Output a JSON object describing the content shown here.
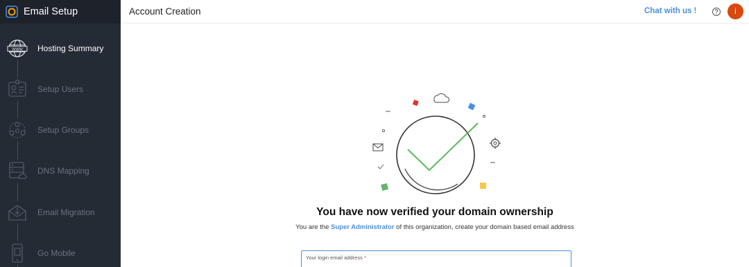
{
  "sidebar": {
    "title": "Email Setup",
    "items": [
      {
        "label": "Hosting Summary",
        "icon": "globe-www-icon",
        "active": true
      },
      {
        "label": "Setup Users",
        "icon": "user-badge-icon",
        "active": false
      },
      {
        "label": "Setup Groups",
        "icon": "group-icon",
        "active": false
      },
      {
        "label": "DNS Mapping",
        "icon": "dns-server-icon",
        "active": false
      },
      {
        "label": "Email Migration",
        "icon": "email-migration-icon",
        "active": false
      },
      {
        "label": "Go Mobile",
        "icon": "mobile-icon",
        "active": false
      }
    ]
  },
  "header": {
    "title": "Account Creation",
    "chat": "Chat with us !",
    "avatar_initial": "i"
  },
  "main": {
    "heading": "You have now verified your domain ownership",
    "sub_prefix": "You are the ",
    "sub_highlight": "Super Administrator",
    "sub_suffix": " of this organization, create your domain based email address",
    "email_label": "Your login email address",
    "required_mark": "*"
  },
  "colors": {
    "sidebar_bg": "#252b35",
    "accent_blue": "#4a90e2",
    "check_green": "#5cb85c",
    "avatar": "#d9480f"
  }
}
